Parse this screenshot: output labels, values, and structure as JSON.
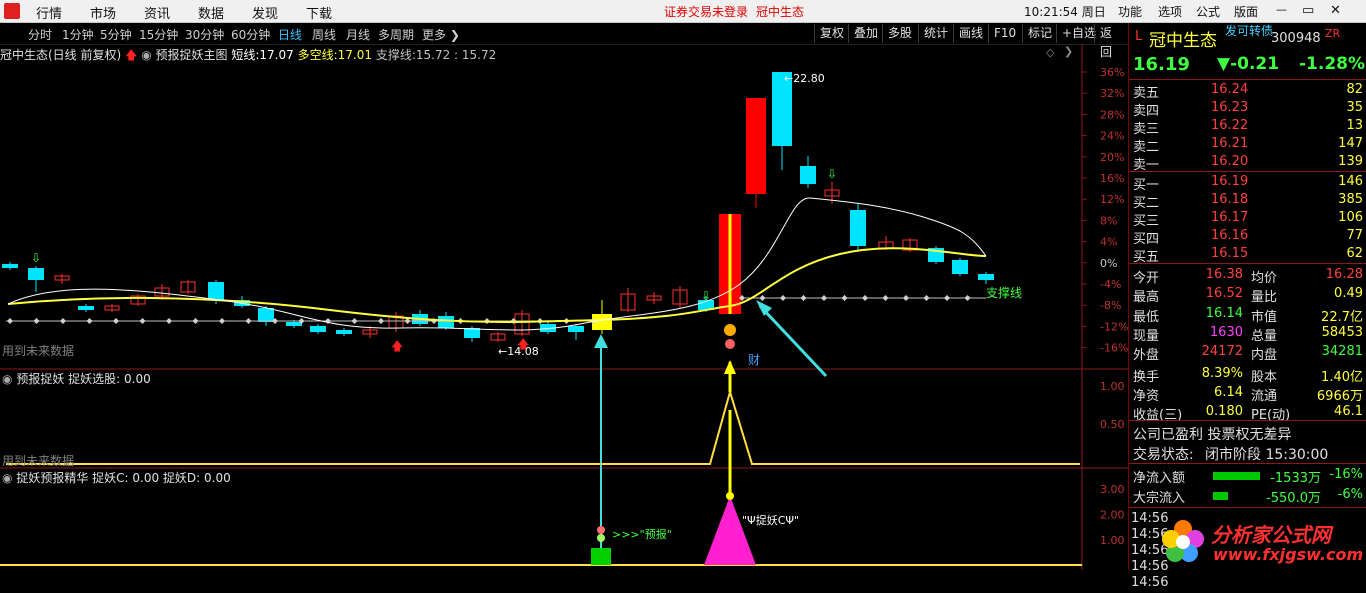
{
  "menu": {
    "items": [
      "行情",
      "市场",
      "资讯",
      "数据",
      "发现",
      "下载"
    ],
    "notice": "证券交易未登录",
    "stock_name": "冠中生态",
    "clock": "10:21:54 周日",
    "right_items": [
      "功能",
      "选项",
      "公式",
      "版面"
    ]
  },
  "window_controls": {
    "minimize": "—",
    "restore": "▭",
    "close": "✕"
  },
  "toolbar": {
    "periods": [
      "分时",
      "1分钟",
      "5分钟",
      "15分钟",
      "30分钟",
      "60分钟",
      "日线",
      "周线",
      "月线",
      "多周期",
      "更多"
    ],
    "active_period": "日线",
    "buttons": [
      "复权",
      "叠加",
      "多股",
      "统计",
      "画线",
      "F10",
      "标记",
      "+自选",
      "返回"
    ]
  },
  "main_chart": {
    "title": "冠中生态(日线 前复权)",
    "indicator": "预报捉妖主图",
    "values": [
      {
        "label": "短线:",
        "value": "17.07"
      },
      {
        "label": "多空线:",
        "value": "17.01"
      },
      {
        "label": "支撑线:",
        "value": "15.72 : 15.72"
      }
    ],
    "axis": [
      "36%",
      "32%",
      "28%",
      "24%",
      "20%",
      "16%",
      "12%",
      "8%",
      "4%",
      "0%",
      "-4%",
      "-8%",
      "-12%",
      "-16%"
    ],
    "high_label": "←22.80",
    "low_label": "←14.08",
    "support_label": "支撑线",
    "cai_label": "财",
    "future_note": "用到未来数据"
  },
  "panel2": {
    "title": "预报捉妖",
    "value_label": "捉妖选股: 0.00",
    "axis": [
      "1.00",
      "0.50"
    ],
    "future_note": "用到未来数据"
  },
  "panel3": {
    "title": "捉妖预报精华",
    "value_label": "捉妖C: 0.00  捉妖D: 0.00",
    "axis": [
      "3.00",
      "2.00",
      "1.00"
    ],
    "forecast_label": ">>>\"预报\"",
    "zhuoyao_label": "\"Ψ捉妖CΨ\""
  },
  "quote": {
    "prefix": "L",
    "name": "冠中生态",
    "tag": "发可转债",
    "code": "300948",
    "zr": "ZR",
    "price": "16.19",
    "change": "▼-0.21",
    "change_pct": "-1.28%",
    "asks": [
      {
        "label": "卖五",
        "price": "16.24",
        "vol": "82"
      },
      {
        "label": "卖四",
        "price": "16.23",
        "vol": "35"
      },
      {
        "label": "卖三",
        "price": "16.22",
        "vol": "13"
      },
      {
        "label": "卖二",
        "price": "16.21",
        "vol": "147"
      },
      {
        "label": "卖一",
        "price": "16.20",
        "vol": "139"
      }
    ],
    "bids": [
      {
        "label": "买一",
        "price": "16.19",
        "vol": "146"
      },
      {
        "label": "买二",
        "price": "16.18",
        "vol": "385"
      },
      {
        "label": "买三",
        "price": "16.17",
        "vol": "106"
      },
      {
        "label": "买四",
        "price": "16.16",
        "vol": "77"
      },
      {
        "label": "买五",
        "price": "16.15",
        "vol": "62"
      }
    ],
    "stats": [
      {
        "l1": "今开",
        "v1": "16.38",
        "c1": "#ff4040",
        "l2": "均价",
        "v2": "16.28",
        "c2": "#ff4040"
      },
      {
        "l1": "最高",
        "v1": "16.52",
        "c1": "#ff4040",
        "l2": "量比",
        "v2": "0.49",
        "c2": "#ffff40"
      },
      {
        "l1": "最低",
        "v1": "16.14",
        "c1": "#40ff40",
        "l2": "市值",
        "v2": "22.7亿",
        "c2": "#ffff40"
      },
      {
        "l1": "现量",
        "v1": "1630",
        "c1": "#ff40ff",
        "l2": "总量",
        "v2": "58453",
        "c2": "#ffff40"
      },
      {
        "l1": "外盘",
        "v1": "24172",
        "c1": "#ff4040",
        "l2": "内盘",
        "v2": "34281",
        "c2": "#40ff40"
      },
      {
        "l1": "换手",
        "v1": "8.39%",
        "c1": "#ffff40",
        "l2": "股本",
        "v2": "1.40亿",
        "c2": "#ffff40"
      },
      {
        "l1": "净资",
        "v1": "6.14",
        "c1": "#ffff40",
        "l2": "流通",
        "v2": "6966万",
        "c2": "#ffff40"
      },
      {
        "l1": "收益(三)",
        "v1": "0.180",
        "c1": "#ffff40",
        "l2": "PE(动)",
        "v2": "46.1",
        "c2": "#ffff40"
      }
    ],
    "company_note": "公司已盈利 投票权无差异",
    "trade_status_label": "交易状态:",
    "trade_status": "闭市阶段 15:30:00",
    "flows": [
      {
        "label": "净流入额",
        "value": "-1533万",
        "pct": "-16%",
        "bar": 0.78
      },
      {
        "label": "大宗流入",
        "value": "-550.0万",
        "pct": "-6%",
        "bar": 0.25
      }
    ],
    "ticks": [
      "14:56",
      "14:56",
      "14:56",
      "14:56",
      "14:56"
    ],
    "watermark_text": "分析家公式网",
    "watermark_url": "www.fxjgsw.com"
  },
  "colors": {
    "up": "#ff3030",
    "down": "#00e4ff",
    "yellow": "#ffff40",
    "line_white": "#ffffff",
    "support": "#c0c0c0",
    "magenta": "#ff20d0",
    "green": "#00d000"
  }
}
